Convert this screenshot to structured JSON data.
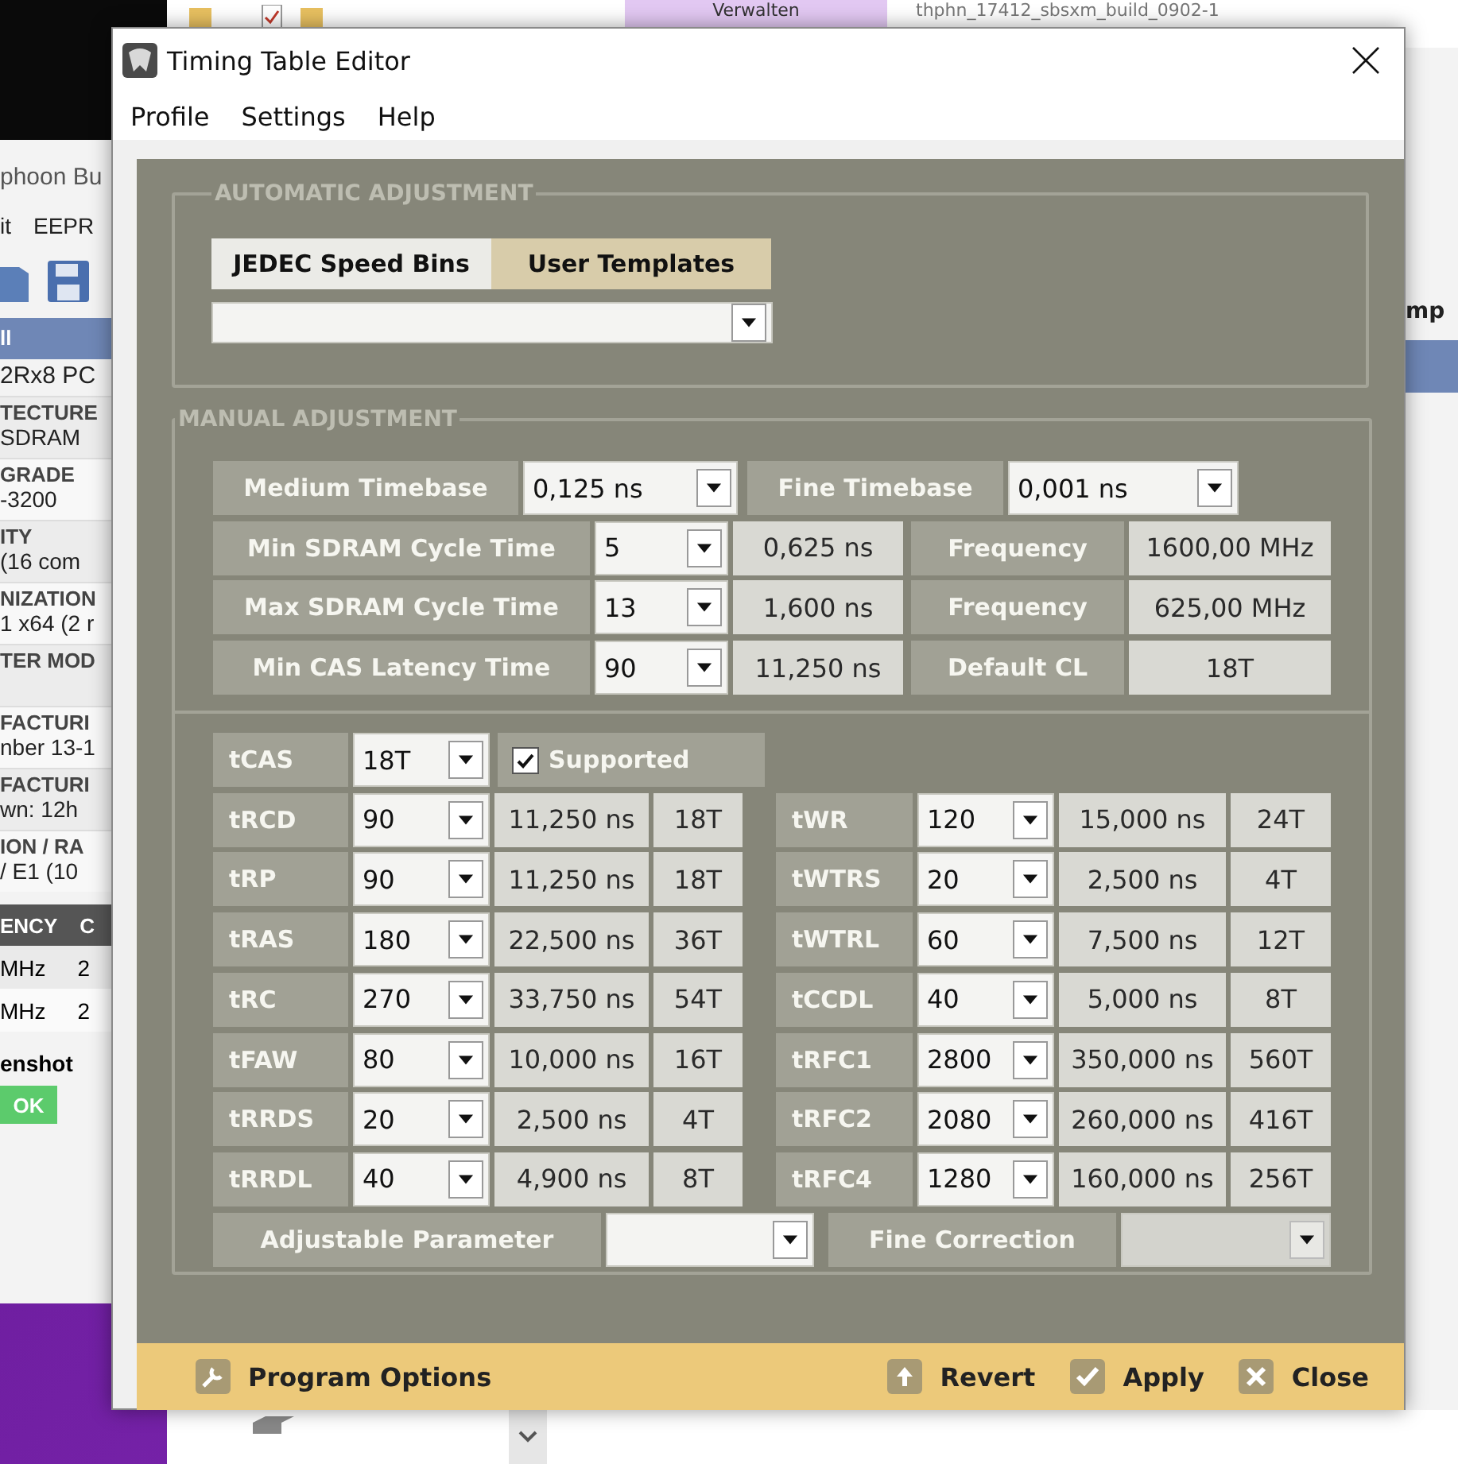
{
  "desktop": {
    "top_bar": {
      "tab": "Verwalten",
      "path": "thphn_17412_sbsxm_build_0902-1"
    },
    "back_window": {
      "title": "phoon Bu",
      "menu": [
        "it",
        "EEPR"
      ],
      "tab": "ll",
      "summary": "2Rx8 PC",
      "fields": [
        {
          "label": "TECTURE",
          "value": "SDRAM"
        },
        {
          "label": "GRADE",
          "value": "-3200"
        },
        {
          "label": "ITY",
          "value": "(16 com"
        },
        {
          "label": "NIZATION",
          "value": "1 x64 (2 r"
        },
        {
          "label": "TER MOD"
        },
        {
          "label": "FACTURI",
          "value": "nber 13-1"
        },
        {
          "label": "FACTURI",
          "value": "wn: 12h"
        },
        {
          "label": "ION / RA",
          "value": "/ E1 (10"
        }
      ],
      "table": {
        "columns": [
          "ENCY",
          "C"
        ],
        "rows": [
          [
            "MHz",
            "2"
          ],
          [
            "MHz",
            "2"
          ]
        ]
      },
      "section": "enshot",
      "button": "OK"
    },
    "right_window": {
      "label": "mp"
    }
  },
  "dialog": {
    "title": "Timing Table Editor",
    "menu": [
      "Profile",
      "Settings",
      "Help"
    ],
    "automatic": {
      "title": "AUTOMATIC ADJUSTMENT",
      "tabs": [
        {
          "label": "JEDEC Speed Bins",
          "selected": true
        },
        {
          "label": "User Templates",
          "selected": false
        }
      ]
    },
    "manual": {
      "title": "MANUAL ADJUSTMENT",
      "timebase": [
        {
          "label": "Medium Timebase",
          "value": "0,125 ns"
        },
        {
          "label": "Fine Timebase",
          "value": "0,001 ns"
        }
      ],
      "cycle_rows": [
        {
          "label": "Min SDRAM Cycle Time",
          "value": "5",
          "time": "0,625 ns",
          "result_label": "Frequency",
          "result": "1600,00 MHz"
        },
        {
          "label": "Max SDRAM Cycle Time",
          "value": "13",
          "time": "1,600 ns",
          "result_label": "Frequency",
          "result": "625,00 MHz"
        },
        {
          "label": "Min CAS Latency Time",
          "value": "90",
          "time": "11,250 ns",
          "result_label": "Default CL",
          "result": "18T"
        }
      ],
      "tcas": {
        "label": "tCAS",
        "value": "18T",
        "checkbox_label": "Supported",
        "checked": true
      },
      "timings": [
        {
          "label": "tRCD",
          "value": "90",
          "time": "11,250 ns",
          "cycles": "18T"
        },
        {
          "label": "tWR",
          "value": "120",
          "time": "15,000 ns",
          "cycles": "24T"
        },
        {
          "label": "tRP",
          "value": "90",
          "time": "11,250 ns",
          "cycles": "18T"
        },
        {
          "label": "tWTRS",
          "value": "20",
          "time": "2,500 ns",
          "cycles": "4T"
        },
        {
          "label": "tRAS",
          "value": "180",
          "time": "22,500 ns",
          "cycles": "36T"
        },
        {
          "label": "tWTRL",
          "value": "60",
          "time": "7,500 ns",
          "cycles": "12T"
        },
        {
          "label": "tRC",
          "value": "270",
          "time": "33,750 ns",
          "cycles": "54T"
        },
        {
          "label": "tCCDL",
          "value": "40",
          "time": "5,000 ns",
          "cycles": "8T"
        },
        {
          "label": "tFAW",
          "value": "80",
          "time": "10,000 ns",
          "cycles": "16T"
        },
        {
          "label": "tRFC1",
          "value": "2800",
          "time": "350,000 ns",
          "cycles": "560T"
        },
        {
          "label": "tRRDS",
          "value": "20",
          "time": "2,500 ns",
          "cycles": "4T"
        },
        {
          "label": "tRFC2",
          "value": "2080",
          "time": "260,000 ns",
          "cycles": "416T"
        },
        {
          "label": "tRRDL",
          "value": "40",
          "time": "4,900 ns",
          "cycles": "8T"
        },
        {
          "label": "tRFC4",
          "value": "1280",
          "time": "160,000 ns",
          "cycles": "256T"
        }
      ],
      "adjust": [
        {
          "label": "Adjustable Parameter",
          "disabled": false
        },
        {
          "label": "Fine Correction",
          "disabled": true
        }
      ]
    },
    "footer": {
      "options": "Program Options",
      "buttons": [
        {
          "kind": "revert",
          "label": "Revert"
        },
        {
          "kind": "apply",
          "label": "Apply"
        },
        {
          "kind": "close",
          "label": "Close"
        }
      ]
    }
  }
}
